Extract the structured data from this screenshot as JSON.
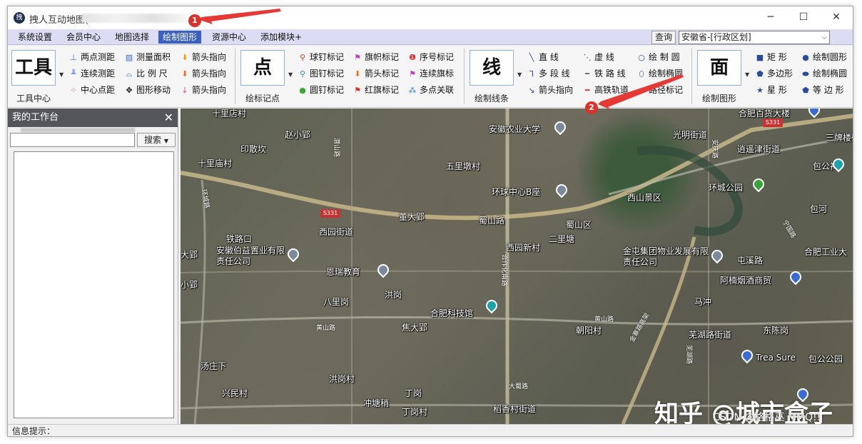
{
  "window": {
    "title": "拽人互动地图("
  },
  "menu": [
    "系统设置",
    "会员中心",
    "地图选择",
    "绘制图形",
    "资源中心",
    "添加模块+"
  ],
  "menu_active_index": 3,
  "query_button": "查询",
  "region_select": "安徽省-[行政区划]",
  "ribbon": {
    "tool": {
      "big": "工具",
      "caption": "工具中心",
      "items": [
        "两点测距",
        "连续测距",
        "中心点距",
        "测量面积",
        "比 例 尺",
        "图形移动",
        "箭头指向",
        "箭头指向",
        "箭头指向"
      ]
    },
    "point": {
      "big": "点",
      "caption": "绘标记点",
      "items": [
        "球钉标记",
        "图钉标记",
        "圆钉标记",
        "旗帜标记",
        "箭头标记",
        "红旗标记",
        "序号标记",
        "连续旗标",
        "多点关联"
      ]
    },
    "line": {
      "big": "线",
      "caption": "绘制线条",
      "items": [
        "直  线",
        "多 段 线",
        "箭头指向",
        "虚  线",
        "铁 路 线",
        "高铁轨道",
        "绘 制 圆",
        "绘制椭圆",
        "路径标记"
      ]
    },
    "area": {
      "big": "面",
      "caption": "绘制图形",
      "items": [
        "矩  形",
        "多边形",
        "星  形",
        "绘制圆形",
        "绘制椭圆",
        "等 边 形"
      ]
    }
  },
  "panel": {
    "title": "我的工作台",
    "search_button": "搜索"
  },
  "status": {
    "label": "信息提示："
  },
  "map": {
    "labels": [
      "十里店村",
      "赵小郢",
      "印散坎",
      "十里庙村",
      "安徽农业大学",
      "五里墩村",
      "环球中心B座",
      "西山景区",
      "环城公园",
      "包公祠",
      "光明街道",
      "逍遥津街道",
      "三牌楼街",
      "合肥百货大楼",
      "董大郢",
      "蜀山路",
      "西园街道",
      "蜀山区",
      "二里塘",
      "西园新村",
      "铁路口",
      "安徽伯益置业有限责任公司",
      "恩瑞教育",
      "金屯集团物业发展有限责任公司",
      "屯溪路",
      "合肥工业大",
      "阿楠烟酒商贸",
      "八里岗",
      "洪岗",
      "合肥科技馆",
      "马冲",
      "黄山路",
      "焦大郢",
      "朝阳村",
      "芜湖路街道",
      "东陈岗",
      "Trea Sure",
      "汤庄下",
      "洪岗村",
      "兴民村",
      "冲塘稍",
      "丁岗",
      "丁岗村",
      "稻香村街道",
      "包公公园",
      "小郢",
      "大郢",
      "包河"
    ],
    "road_shields": [
      "S331",
      "S331"
    ],
    "roads": [
      "环城路",
      "潜山路",
      "合作化南路",
      "金寨路高架",
      "黄山路",
      "芜湖路",
      "安庆路",
      "宁国路",
      "大蜀路"
    ]
  },
  "watermark": {
    "main": "知乎 @城市盒子",
    "sub": "CSDN @格格巫 MMQ!!"
  },
  "badges": [
    "1",
    "2"
  ],
  "colors": {
    "menu_bg": "#dcdcf4",
    "menu_active": "#3b5fbf",
    "panel_head": "#54565a",
    "badge": "#d9342b",
    "arrow": "#e53935"
  }
}
